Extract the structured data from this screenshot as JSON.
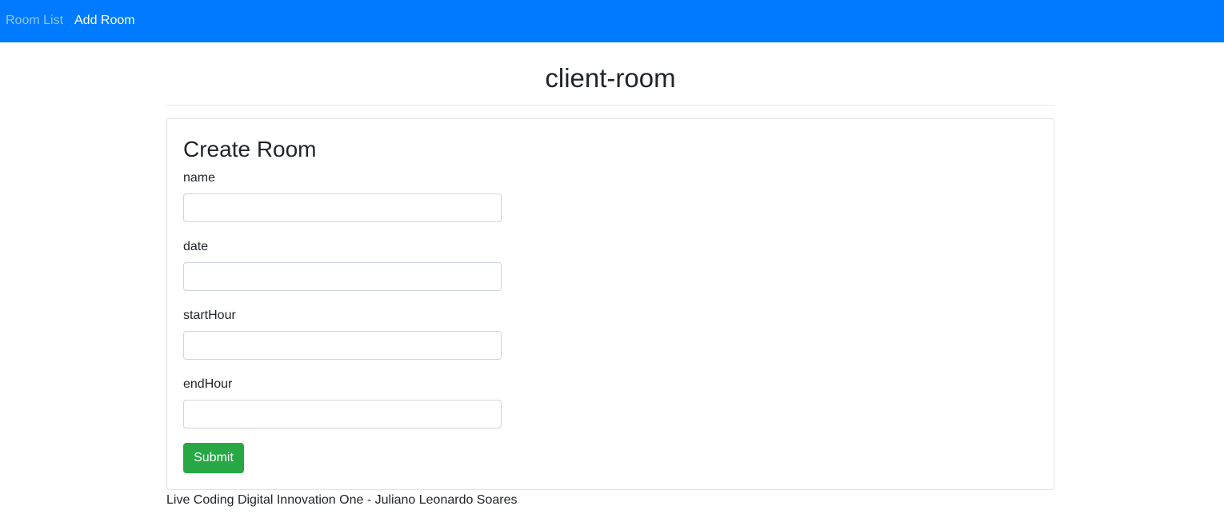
{
  "colors": {
    "navbar_bg": "#007bff",
    "submit_bg": "#28a745"
  },
  "navbar": {
    "items": [
      {
        "label": "Room List",
        "active": false
      },
      {
        "label": "Add Room",
        "active": true
      }
    ]
  },
  "page": {
    "title": "client-room"
  },
  "form": {
    "title": "Create Room",
    "fields": [
      {
        "label": "name",
        "value": ""
      },
      {
        "label": "date",
        "value": ""
      },
      {
        "label": "startHour",
        "value": ""
      },
      {
        "label": "endHour",
        "value": ""
      }
    ],
    "submit_label": "Submit"
  },
  "footer": {
    "text": "Live Coding Digital Innovation One - Juliano Leonardo Soares"
  }
}
